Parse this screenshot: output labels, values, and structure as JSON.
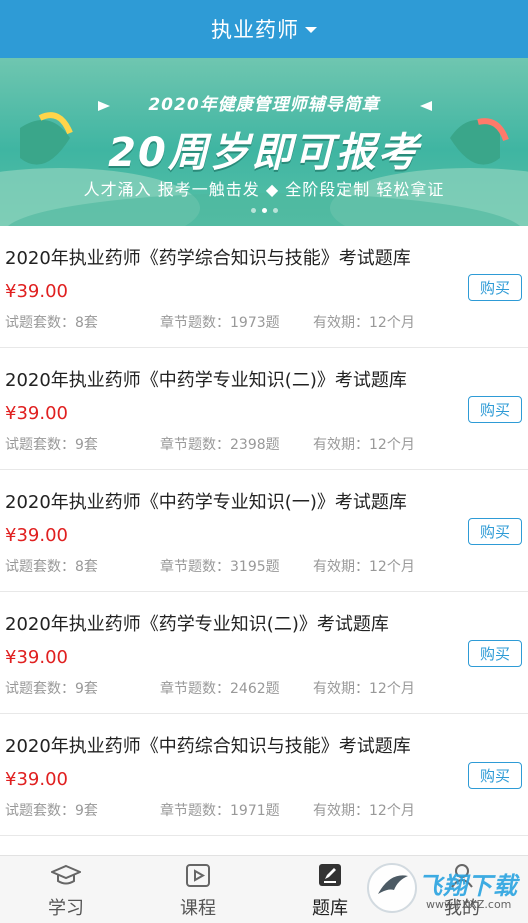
{
  "header": {
    "title": "执业药师"
  },
  "banner": {
    "top_line": "2020年健康管理师辅导简章",
    "big_line": "20周岁即可报考",
    "bottom_line": "人才涌入 报考一触击发 ◆ 全阶段定制 轻松拿证"
  },
  "products": [
    {
      "name": "2020年执业药师《药学综合知识与技能》考试题库",
      "price": "¥39.00",
      "sets": "试题套数：8套",
      "chapters": "章节题数：1973题",
      "validity": "有效期：12个月",
      "buy_label": "购买"
    },
    {
      "name": "2020年执业药师《中药学专业知识(二)》考试题库",
      "price": "¥39.00",
      "sets": "试题套数：9套",
      "chapters": "章节题数：2398题",
      "validity": "有效期：12个月",
      "buy_label": "购买"
    },
    {
      "name": "2020年执业药师《中药学专业知识(一)》考试题库",
      "price": "¥39.00",
      "sets": "试题套数：8套",
      "chapters": "章节题数：3195题",
      "validity": "有效期：12个月",
      "buy_label": "购买"
    },
    {
      "name": "2020年执业药师《药学专业知识(二)》考试题库",
      "price": "¥39.00",
      "sets": "试题套数：9套",
      "chapters": "章节题数：2462题",
      "validity": "有效期：12个月",
      "buy_label": "购买"
    },
    {
      "name": "2020年执业药师《中药综合知识与技能》考试题库",
      "price": "¥39.00",
      "sets": "试题套数：9套",
      "chapters": "章节题数：1971题",
      "validity": "有效期：12个月",
      "buy_label": "购买"
    }
  ],
  "tabbar": {
    "tabs": [
      {
        "label": "学习",
        "icon": "graduation-cap-icon"
      },
      {
        "label": "课程",
        "icon": "video-course-icon"
      },
      {
        "label": "题库",
        "icon": "edit-question-bank-icon",
        "active": true
      },
      {
        "label": "我的",
        "icon": "user-icon"
      }
    ]
  },
  "watermark": {
    "text": "飞翔下载",
    "url": "www.FXXZ.com"
  },
  "colors": {
    "header": "#2e9bd6",
    "price": "#e02020",
    "accent": "#2e9bd6"
  }
}
